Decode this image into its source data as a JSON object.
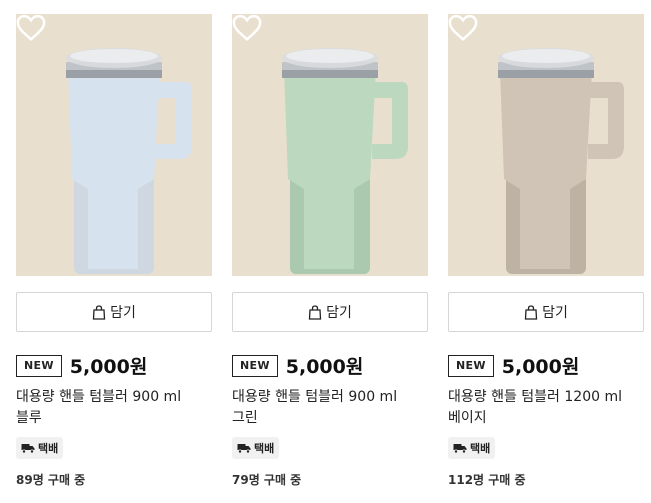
{
  "products": [
    {
      "cart_label": "담기",
      "badge": "NEW",
      "price": "5,000원",
      "title_line1": "대용량 핸들 텀블러 900 ml",
      "title_line2": "블루",
      "shipping": "택배",
      "buyers": "89명 구매 중",
      "color": "#d6e2ee"
    },
    {
      "cart_label": "담기",
      "badge": "NEW",
      "price": "5,000원",
      "title_line1": "대용량 핸들 텀블러 900 ml",
      "title_line2": "그린",
      "shipping": "택배",
      "buyers": "79명 구매 중",
      "color": "#bcd8bf"
    },
    {
      "cart_label": "담기",
      "badge": "NEW",
      "price": "5,000원",
      "title_line1": "대용량 핸들 텀블러 1200 ml",
      "title_line2": "베이지",
      "shipping": "택배",
      "buyers": "112명 구매 중",
      "color": "#cfc4b5"
    }
  ]
}
